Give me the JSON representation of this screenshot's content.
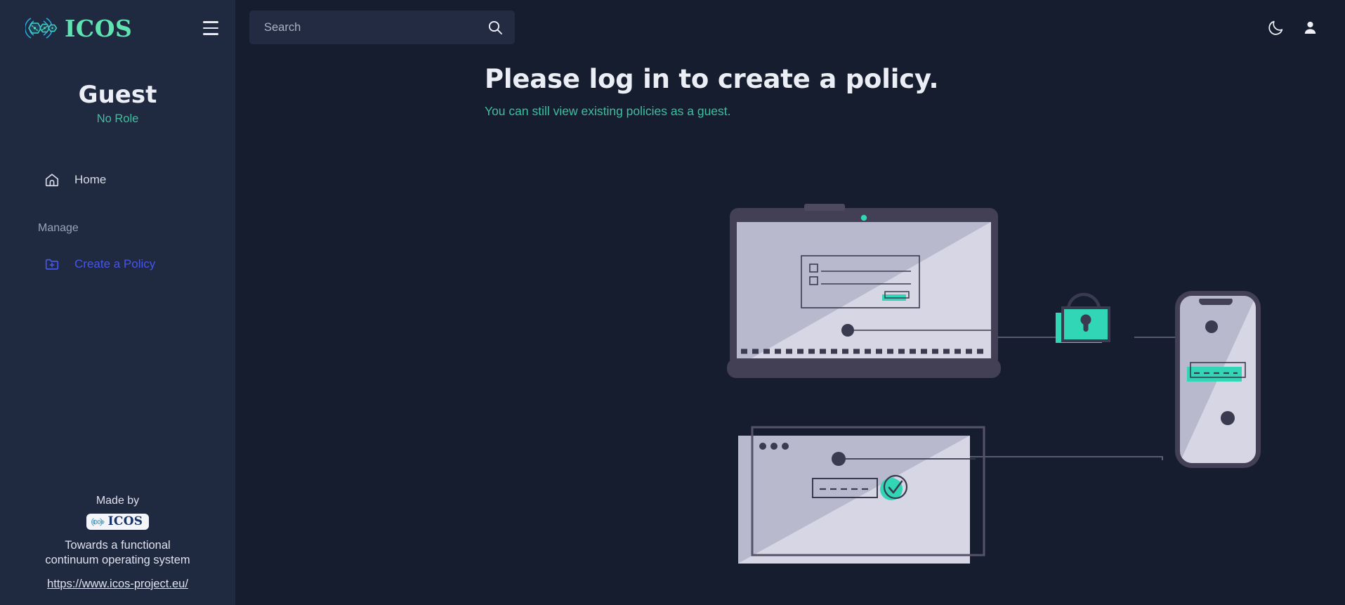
{
  "brand": {
    "logo_text": "ICOS",
    "logo_mark_icon": "icos-hexagon-network-icon"
  },
  "sidebar": {
    "menu_toggle_icon": "hamburger-menu-icon",
    "profile": {
      "name": "Guest",
      "role": "No Role"
    },
    "items": [
      {
        "label": "Home",
        "icon": "home-icon",
        "accent": false
      }
    ],
    "section_label": "Manage",
    "manage_items": [
      {
        "label": "Create a Policy",
        "icon": "folder-plus-icon",
        "accent": true
      }
    ],
    "footer": {
      "made_by": "Made by",
      "badge_text": "ICOS",
      "badge_icon": "icos-hexagon-network-icon",
      "tagline": "Towards a functional continuum operating system",
      "link": "https://www.icos-project.eu/"
    }
  },
  "topbar": {
    "search": {
      "placeholder": "Search",
      "value": "",
      "icon": "search-icon"
    },
    "dark_mode_icon": "moon-icon",
    "account_icon": "person-icon"
  },
  "main": {
    "title": "Please log in to create a policy.",
    "subtitle": "You can still view existing policies as a guest.",
    "illustration_name": "secure-login-illustration"
  },
  "colors": {
    "sidebar_bg": "#1f2940",
    "main_bg": "#161d2e",
    "accent_teal": "#3fbfa0",
    "accent_indigo": "#4656e8",
    "logo_green": "#5fe3b0",
    "text_light": "#eceef5",
    "illus_screen": "#d2d2e2",
    "illus_frame": "#433f55",
    "illus_teal": "#31d6b6",
    "illus_dark": "#3a3a50"
  }
}
